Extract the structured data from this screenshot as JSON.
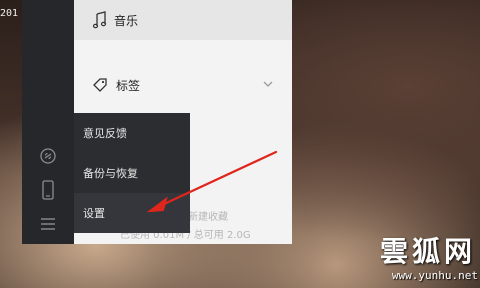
{
  "desktop": {
    "corner_text": "201"
  },
  "rail": {
    "icons": [
      "link-icon",
      "phone-icon",
      "menu-icon"
    ]
  },
  "panel": {
    "music_label": "音乐",
    "tags_label": "标签",
    "faded_line1": "接新建收藏",
    "faded_line2": "已使用 0.01M / 总可用 2.0G"
  },
  "menu": {
    "items": [
      {
        "label": "意见反馈"
      },
      {
        "label": "备份与恢复"
      },
      {
        "label": "设置"
      }
    ]
  },
  "annotation": {
    "arrow_color": "#e0261c"
  },
  "watermark": {
    "brand": "雲狐网",
    "url": "www.yunhu.net"
  }
}
